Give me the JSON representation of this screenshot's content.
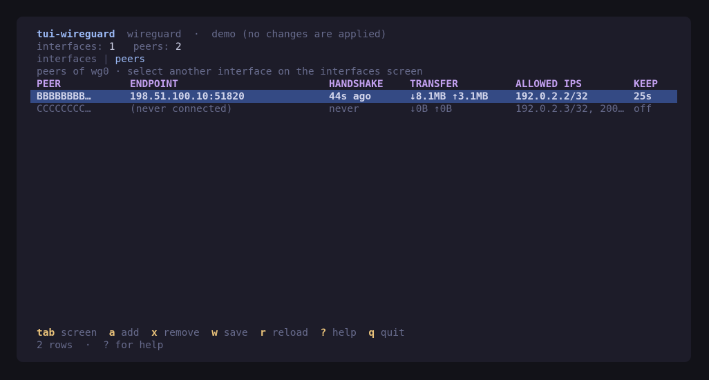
{
  "header": {
    "app_name": "tui-wireguard",
    "backend": "wireguard",
    "separator": "·",
    "mode_note": "demo (no changes are applied)",
    "interfaces_label": "interfaces:",
    "interfaces_count": "1",
    "peers_label": "peers:",
    "peers_count": "2"
  },
  "tabs": {
    "interfaces": "interfaces",
    "divider": "|",
    "peers": "peers"
  },
  "subtitle": "peers of wg0 · select another interface on the interfaces screen",
  "table": {
    "columns": [
      "PEER",
      "ENDPOINT",
      "HANDSHAKE",
      "TRANSFER",
      "ALLOWED IPS",
      "KEEP"
    ],
    "rows": [
      {
        "peer": "BBBBBBBB…",
        "endpoint": "198.51.100.10:51820",
        "handshake": "44s ago",
        "transfer": "↓8.1MB ↑3.1MB",
        "allowed_ips": "192.0.2.2/32",
        "keep": "25s",
        "selected": true
      },
      {
        "peer": "CCCCCCCC…",
        "endpoint": "(never connected)",
        "handshake": "never",
        "transfer": "↓0B ↑0B",
        "allowed_ips": "192.0.2.3/32, 200…",
        "keep": "off",
        "selected": false
      }
    ]
  },
  "footer": {
    "keys": [
      {
        "key": "tab",
        "label": "screen"
      },
      {
        "key": "a",
        "label": "add"
      },
      {
        "key": "x",
        "label": "remove"
      },
      {
        "key": "w",
        "label": "save"
      },
      {
        "key": "r",
        "label": "reload"
      },
      {
        "key": "?",
        "label": "help"
      },
      {
        "key": "q",
        "label": "quit"
      }
    ],
    "status_rows": "2 rows",
    "status_sep": "·",
    "status_help": "? for help"
  },
  "colors": {
    "background": "#1d1c29",
    "selection": "#344a84",
    "accent_blue": "#9ab8f4",
    "header_purple": "#c3a0f0",
    "key_yellow": "#e9c27a",
    "dim_text": "#676b8c"
  }
}
